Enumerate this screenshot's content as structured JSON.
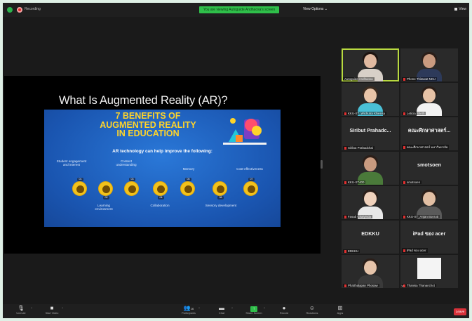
{
  "topbar": {
    "recording_label": "Recording",
    "viewing_banner": "You are viewing Autoguide Andhaosa's screen",
    "view_options": "View Options",
    "view_button": "View"
  },
  "slide": {
    "title": "What Is Augmented Reality (AR)?",
    "infographic_title": "7 BENEFITS OF\nAUGMENTED REALITY\nIN EDUCATION",
    "infographic_subtitle": "AR technology can help improve the following:",
    "top_labels": [
      "Student engagement\nand interest",
      "Content\nunderstanding",
      "Memory",
      "Cost-effectiveness"
    ],
    "bottom_labels": [
      "Learning\nenvironment",
      "Collaboration",
      "Sensory development"
    ],
    "benefit_numbers": [
      "01",
      "02",
      "03",
      "04",
      "05",
      "06",
      "07"
    ],
    "accent_color": "#ffd42a"
  },
  "gallery": {
    "tiles": [
      {
        "name": "Autoguide Andhaosa",
        "type": "video",
        "active": true
      },
      {
        "name": "Phone Thitawat NKU",
        "type": "video"
      },
      {
        "name": "KKU-ST_Wichutra Khiensa",
        "type": "video"
      },
      {
        "name": "Leticia Sheth",
        "type": "video"
      },
      {
        "name": "Siribut Prahadchai",
        "display": "Siribut Prahadc...",
        "type": "name"
      },
      {
        "name": "คณะศึกษาศาสตร์ มหาวิทยาลัย",
        "display": "คณะศึกษาศาสตร์...",
        "type": "name"
      },
      {
        "name": "KKU-ST400",
        "type": "video"
      },
      {
        "name": "smotsoen",
        "display": "smotsoen",
        "type": "name"
      },
      {
        "name": "Fasab Chaiyinda",
        "type": "video"
      },
      {
        "name": "KKU-ST_Anjan Bonrutt",
        "type": "video"
      },
      {
        "name": "EDKKU",
        "display": "EDKKU",
        "type": "name"
      },
      {
        "name": "iPad ของ acer",
        "display": "iPad ของ acer",
        "type": "name"
      },
      {
        "name": "Phatthalapan Phosaw",
        "type": "video"
      },
      {
        "name": "Thanisa Thananchot",
        "type": "video"
      }
    ],
    "page_arrow": "⌄"
  },
  "toolbar": {
    "unmute": "Unmute",
    "start_video": "Start Video",
    "participants": "Participants",
    "participants_count": "16",
    "chat": "Chat",
    "share_screen": "Share Screen",
    "record": "Record",
    "reactions": "Reactions",
    "apps": "Apps",
    "leave": "Leave"
  }
}
